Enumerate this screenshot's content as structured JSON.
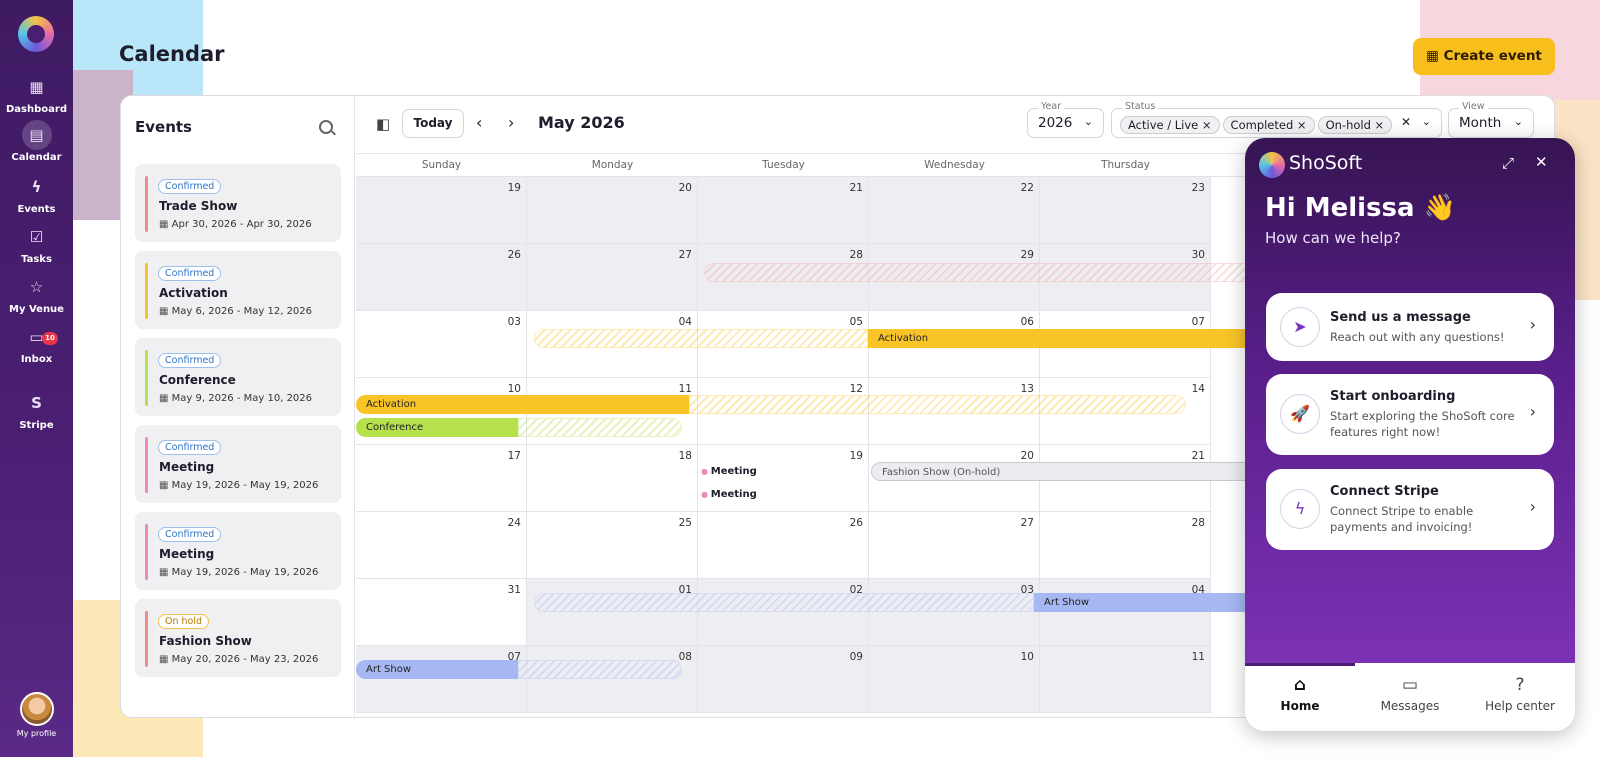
{
  "app": {
    "title": "Calendar",
    "create_label": "Create event"
  },
  "sidebar": {
    "items": [
      {
        "label": "Dashboard",
        "icon": "grid-icon"
      },
      {
        "label": "Calendar",
        "icon": "calendar-icon"
      },
      {
        "label": "Events",
        "icon": "lightning-icon"
      },
      {
        "label": "Tasks",
        "icon": "clipboard-icon"
      },
      {
        "label": "My Venue",
        "icon": "star-icon"
      },
      {
        "label": "Inbox",
        "icon": "inbox-icon",
        "badge": "10"
      },
      {
        "label": "Stripe",
        "icon": "S"
      }
    ],
    "profile_label": "My profile"
  },
  "events_panel": {
    "title": "Events",
    "items": [
      {
        "status": "Confirmed",
        "name": "Trade Show",
        "dates": "Apr 30, 2026 - Apr 30, 2026",
        "color": "#f08c8c"
      },
      {
        "status": "Confirmed",
        "name": "Activation",
        "dates": "May 6, 2026 - May 12, 2026",
        "color": "#f7c52b"
      },
      {
        "status": "Confirmed",
        "name": "Conference",
        "dates": "May 9, 2026 - May 10, 2026",
        "color": "#b6e04c"
      },
      {
        "status": "Confirmed",
        "name": "Meeting",
        "dates": "May 19, 2026 - May 19, 2026",
        "color": "#f08bb7"
      },
      {
        "status": "Confirmed",
        "name": "Meeting",
        "dates": "May 19, 2026 - May 19, 2026",
        "color": "#f08bb7"
      },
      {
        "status": "On hold",
        "name": "Fashion Show",
        "dates": "May 20, 2026 - May 23, 2026",
        "color": "#f08c8c"
      }
    ]
  },
  "calendar": {
    "today_label": "Today",
    "month_label": "May 2026",
    "year": {
      "label": "Year",
      "value": "2026"
    },
    "status": {
      "label": "Status",
      "chips": [
        "Active / Live",
        "Completed",
        "On-hold"
      ]
    },
    "view": {
      "label": "View",
      "value": "Month"
    },
    "weekdays": [
      "Sunday",
      "Monday",
      "Tuesday",
      "Wednesday",
      "Thursday"
    ],
    "weeks": [
      [
        "19",
        "20",
        "21",
        "22",
        "23"
      ],
      [
        "26",
        "27",
        "28",
        "29",
        "30"
      ],
      [
        "03",
        "04",
        "05",
        "06",
        "07"
      ],
      [
        "10",
        "11",
        "12",
        "13",
        "14"
      ],
      [
        "17",
        "18",
        "19",
        "20",
        "21"
      ],
      [
        "24",
        "25",
        "26",
        "27",
        "28"
      ],
      [
        "31",
        "01",
        "02",
        "03",
        "04"
      ],
      [
        "07",
        "08",
        "09",
        "10",
        "11"
      ]
    ],
    "bars": {
      "trade_show": "Trade Show",
      "activation_w2": "Activation",
      "activation_w3": "Activation",
      "conference": "Conference",
      "fashion_show": "Fashion Show (On-hold)",
      "art_show_w6": "Art Show",
      "art_show_w7": "Art Show",
      "meeting_1": "Meeting",
      "meeting_2": "Meeting"
    }
  },
  "chat": {
    "brand": "ShoSoft",
    "greeting": "Hi Melissa 👋",
    "subtitle": "How can we help?",
    "cards": [
      {
        "title": "Send us a message",
        "subtitle": "Reach out with any questions!"
      },
      {
        "title": "Start onboarding",
        "subtitle": "Start exploring the ShoSoft core features right now!"
      },
      {
        "title": "Connect Stripe",
        "subtitle": "Connect Stripe to enable payments and invoicing!"
      }
    ],
    "tabs": [
      "Home",
      "Messages",
      "Help center"
    ]
  }
}
